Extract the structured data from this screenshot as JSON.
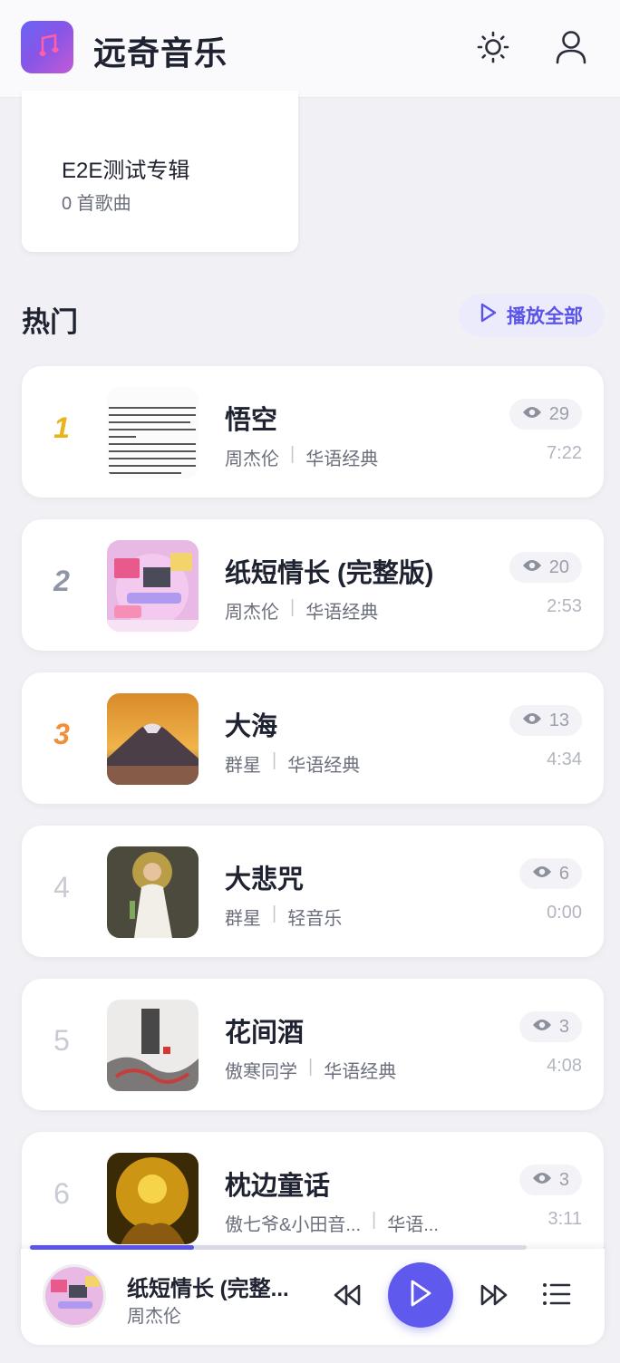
{
  "header": {
    "app_title": "远奇音乐"
  },
  "album": {
    "name": "E2E测试专辑",
    "count": "0 首歌曲"
  },
  "section": {
    "title": "热门",
    "play_all": "播放全部"
  },
  "songs": [
    {
      "rank": "1",
      "title": "悟空",
      "artist": "周杰伦",
      "genre": "华语经典",
      "views": "29",
      "duration": "7:22"
    },
    {
      "rank": "2",
      "title": "纸短情长 (完整版)",
      "artist": "周杰伦",
      "genre": "华语经典",
      "views": "20",
      "duration": "2:53"
    },
    {
      "rank": "3",
      "title": "大海",
      "artist": "群星",
      "genre": "华语经典",
      "views": "13",
      "duration": "4:34"
    },
    {
      "rank": "4",
      "title": "大悲咒",
      "artist": "群星",
      "genre": "轻音乐",
      "views": "6",
      "duration": "0:00"
    },
    {
      "rank": "5",
      "title": "花间酒",
      "artist": "傲寒同学",
      "genre": "华语经典",
      "views": "3",
      "duration": "4:08"
    },
    {
      "rank": "6",
      "title": "枕边童话",
      "artist": "傲七爷&小田音...",
      "genre": "华语...",
      "views": "3",
      "duration": "3:11"
    }
  ],
  "player": {
    "title": "纸短情长 (完整...",
    "artist": "周杰伦",
    "progress": 0.33
  },
  "icons": {
    "logo": "music-note-icon",
    "theme": "sun-icon",
    "account": "user-icon",
    "play_all": "play-outline-icon",
    "views": "eye-icon",
    "prev": "rewind-icon",
    "play": "play-icon",
    "next": "fast-forward-icon",
    "queue": "list-icon"
  },
  "colors": {
    "accent": "#5f59ee",
    "gold": "#e7b41c",
    "silver": "#8e95a6",
    "bronze": "#f08e3a"
  }
}
